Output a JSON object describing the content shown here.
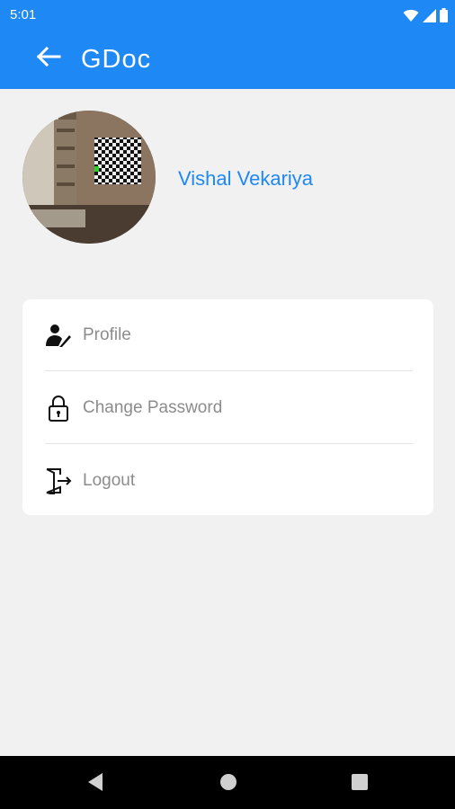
{
  "status_bar": {
    "time": "5:01",
    "icons": [
      "wifi-icon",
      "signal-icon",
      "battery-icon"
    ]
  },
  "app_bar": {
    "title": "GDoc",
    "back_icon": "arrow-left-icon",
    "background_color": "#1e88f5"
  },
  "user": {
    "name": "Vishal Vekariya",
    "avatar": "avatar-photo"
  },
  "menu": {
    "items": [
      {
        "label": "Profile",
        "icon": "user-edit-icon"
      },
      {
        "label": "Change Password",
        "icon": "lock-icon"
      },
      {
        "label": "Logout",
        "icon": "logout-icon"
      }
    ]
  },
  "nav_bar": {
    "buttons": [
      "back-triangle-icon",
      "home-circle-icon",
      "recents-square-icon"
    ]
  },
  "colors": {
    "accent": "#1e88f5",
    "background": "#f1f1f1",
    "card": "#ffffff",
    "menu_text": "#8c8c8c"
  }
}
